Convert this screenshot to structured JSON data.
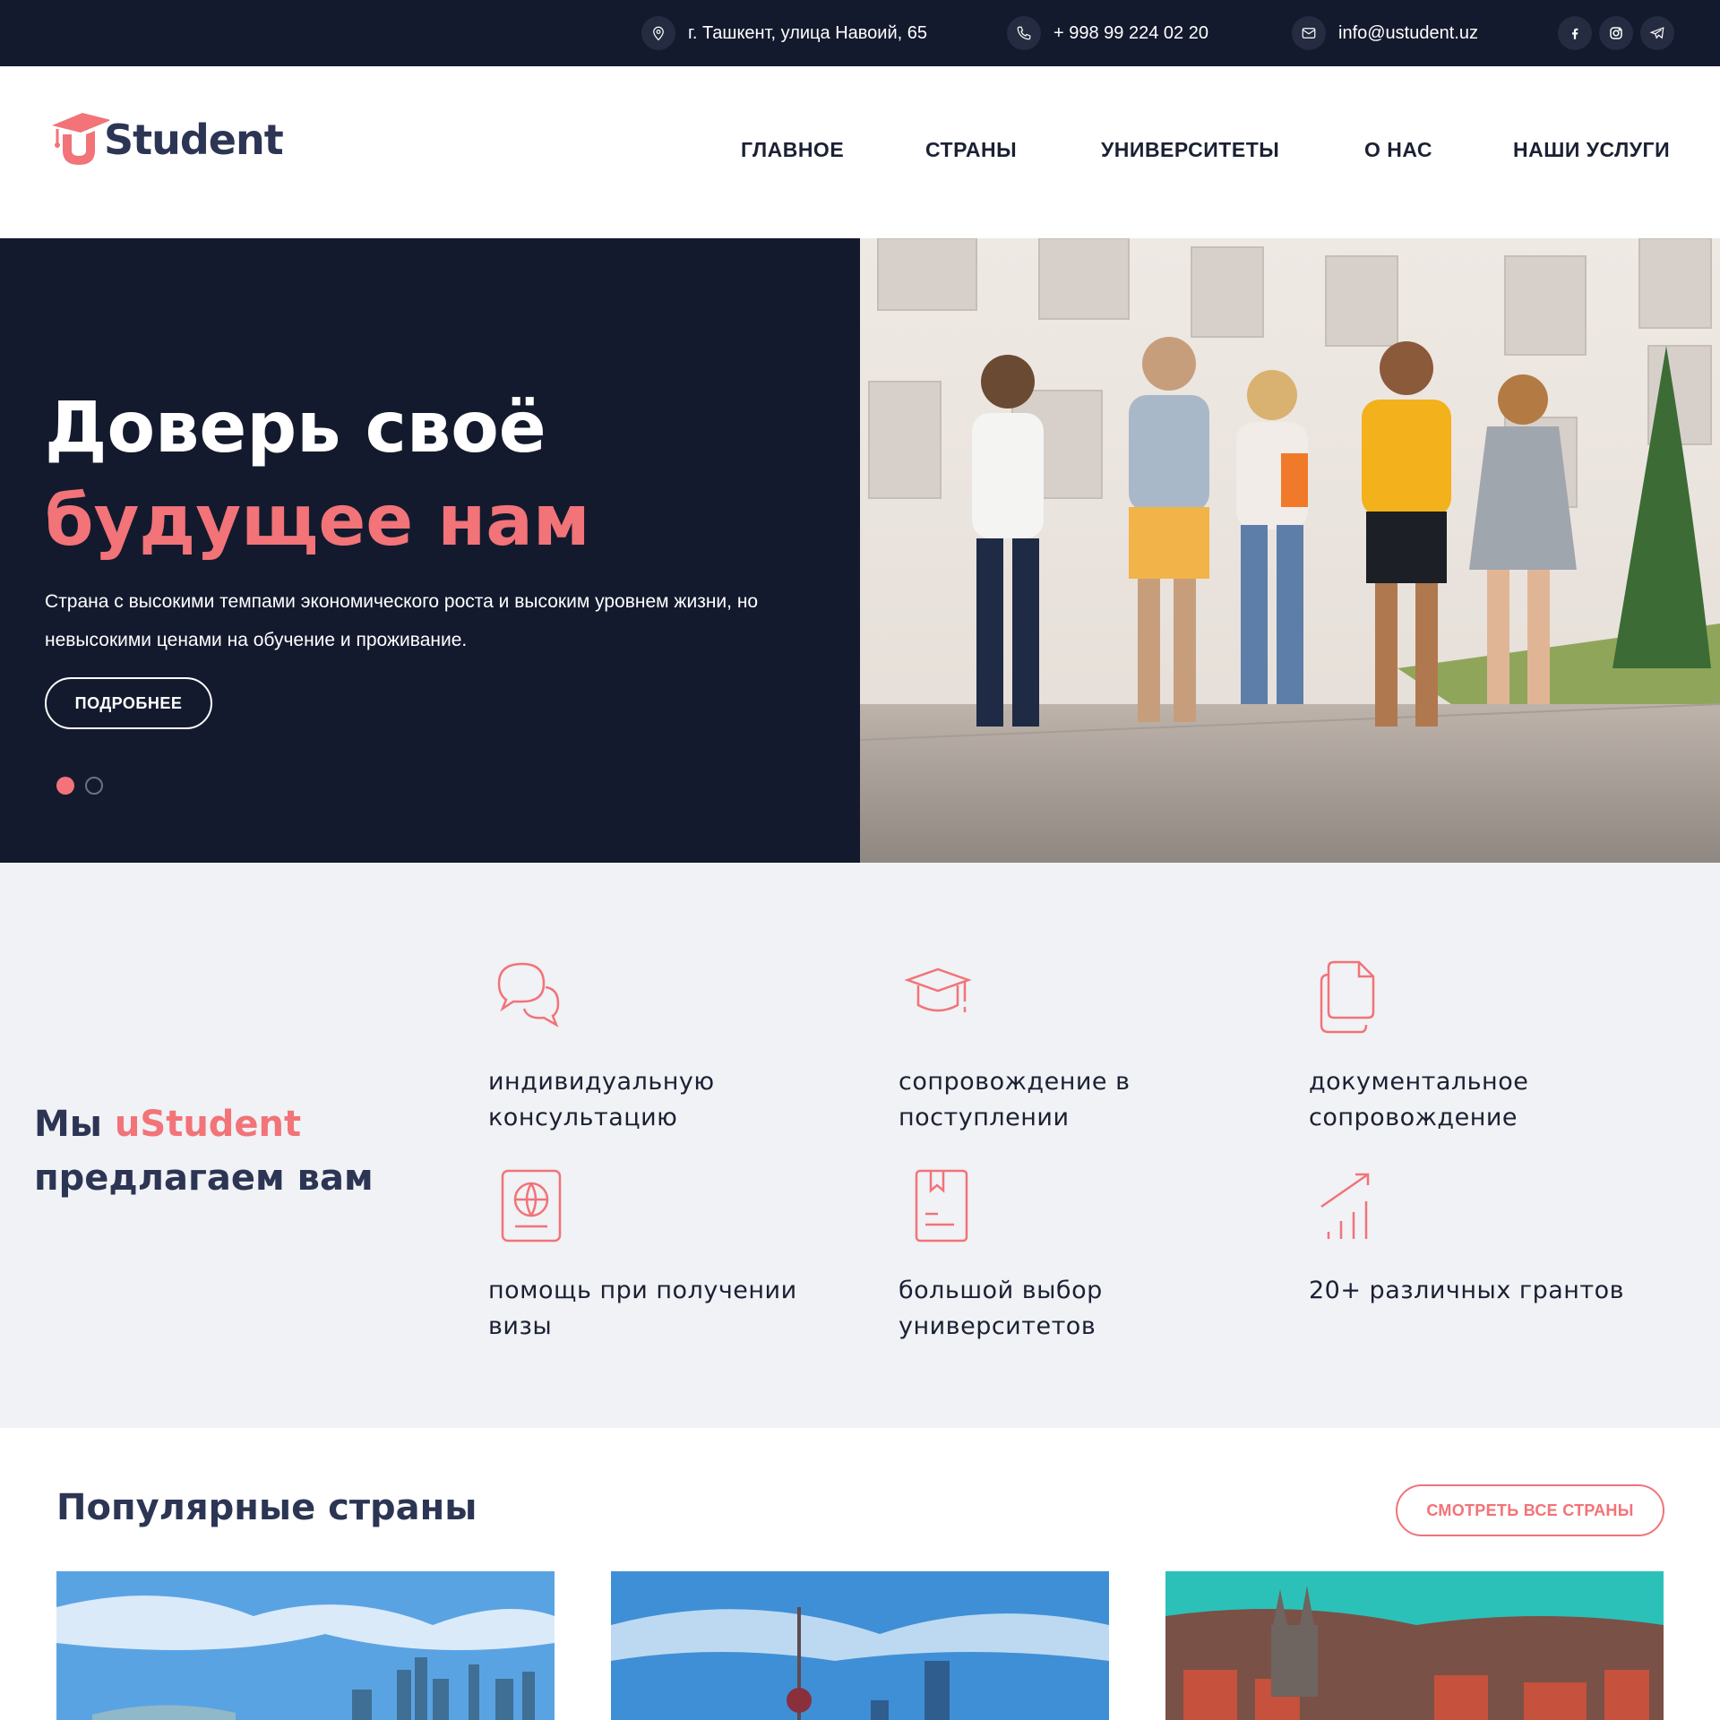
{
  "topbar": {
    "address": "г. Ташкент, улица Навоий, 65",
    "phone": "+ 998 99 224 02 20",
    "email": "info@ustudent.uz",
    "social": [
      "facebook-icon",
      "instagram-icon",
      "telegram-icon"
    ]
  },
  "logo": {
    "text": "Student"
  },
  "nav": {
    "items": [
      "ГЛАВНОЕ",
      "СТРАНЫ",
      "УНИВЕРСИТЕТЫ",
      "О НАС",
      "НАШИ УСЛУГИ"
    ]
  },
  "hero": {
    "title_line1": "Доверь своё",
    "title_line2": "будущее нам",
    "text": "Страна с высокими темпами экономического роста и высоким уровнем жизни, но невысокими ценами на обучение и проживание.",
    "button": "ПОДРОБНЕЕ",
    "slide_count": 2,
    "active_slide": 1
  },
  "services": {
    "title_prefix": "Мы ",
    "title_brand": "uStudent",
    "title_suffix": "предлагаем вам",
    "items": [
      {
        "icon": "chat-icon",
        "label": "индивидуальную консультацию"
      },
      {
        "icon": "graduation-cap-icon",
        "label": "сопровождение в поступлении"
      },
      {
        "icon": "documents-icon",
        "label": "документальное сопровождение"
      },
      {
        "icon": "passport-icon",
        "label": "помощь при получении визы"
      },
      {
        "icon": "book-icon",
        "label": "большой выбор университетов"
      },
      {
        "icon": "growth-chart-icon",
        "label": "20+ различных грантов"
      }
    ]
  },
  "popular": {
    "title": "Популярные страны",
    "button": "СМОТРЕТЬ ВСЕ СТРАНЫ"
  },
  "colors": {
    "accent": "#f27378",
    "dark": "#141a2e",
    "heading": "#2c3553",
    "light_bg": "#f0f2f5"
  }
}
